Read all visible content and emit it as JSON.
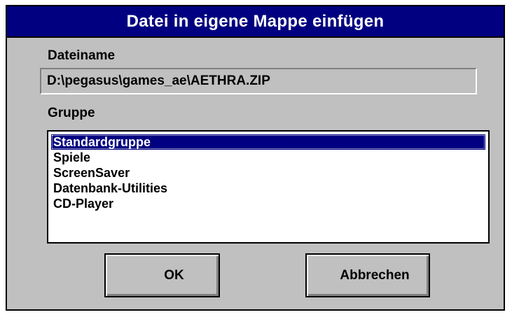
{
  "dialog": {
    "title": "Datei in eigene Mappe einfügen",
    "filename_label": "Dateiname",
    "filename_value": "D:\\pegasus\\games_ae\\AETHRA.ZIP",
    "group_label": "Gruppe",
    "groups": [
      {
        "label": "Standardgruppe",
        "selected": true
      },
      {
        "label": "Spiele",
        "selected": false
      },
      {
        "label": "ScreenSaver",
        "selected": false
      },
      {
        "label": "Datenbank-Utilities",
        "selected": false
      },
      {
        "label": "CD-Player",
        "selected": false
      }
    ],
    "ok_label": "OK",
    "cancel_label": "Abbrechen"
  },
  "colors": {
    "titlebar": "#000080",
    "dialog_face": "#c0c0c0",
    "selection": "#000080"
  }
}
